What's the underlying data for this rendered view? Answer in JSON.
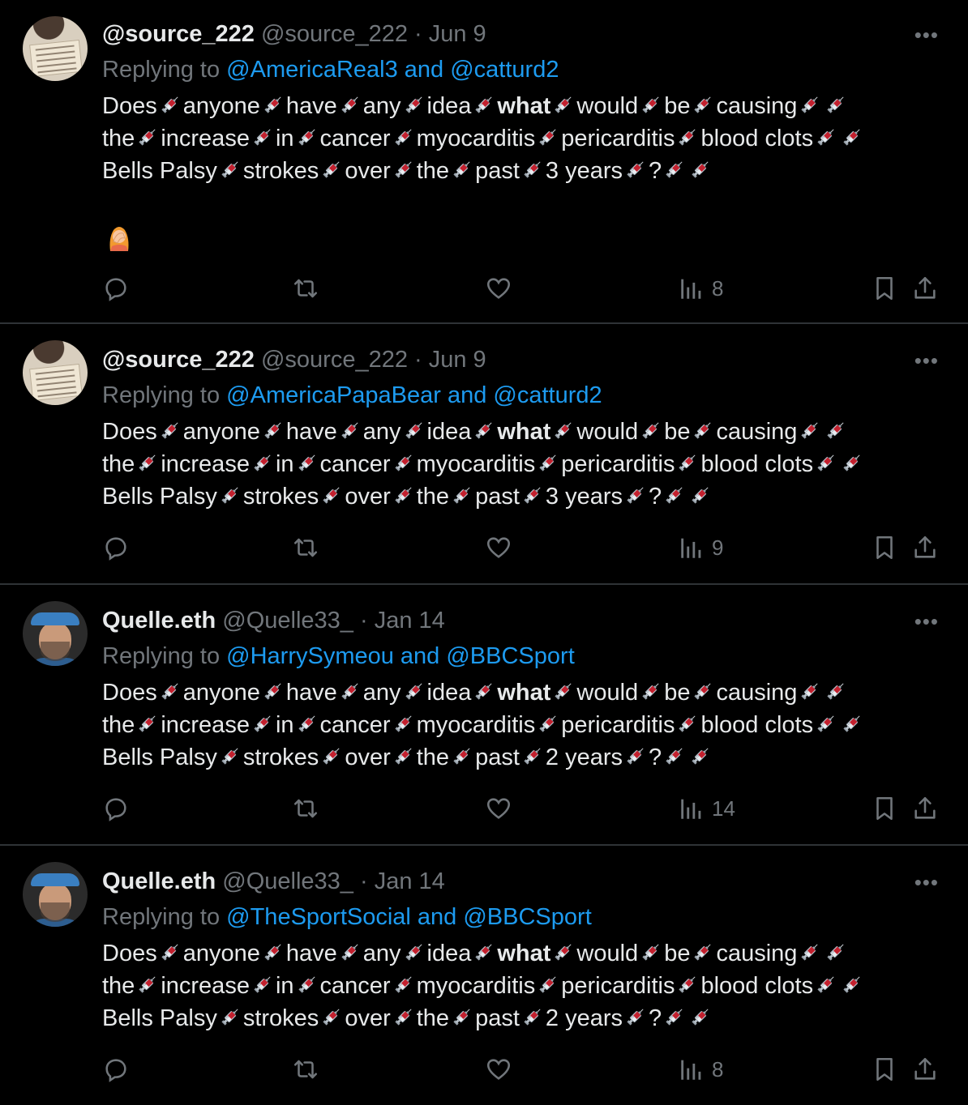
{
  "tweets": [
    {
      "display_name": "@source_222",
      "handle": "@source_222",
      "date": "· Jun 9",
      "replying_prefix": "Replying to",
      "replying_to": "@AmericaReal3 and @catturd2",
      "lines": [
        [
          "Does",
          "anyone",
          "have",
          "any",
          "idea",
          "what",
          "would",
          "be",
          "causing",
          ""
        ],
        [
          "the",
          "increase",
          "in",
          "cancer",
          "myocarditis",
          "pericarditis",
          "blood clots",
          ""
        ],
        [
          "Bells Palsy",
          "strokes",
          "over",
          "the",
          "past",
          "3 years",
          "?",
          ""
        ]
      ],
      "extra_emoji": "woman-facepalm-emoji",
      "views": "8",
      "avatar": "sign-avatar"
    },
    {
      "display_name": "@source_222",
      "handle": "@source_222",
      "date": "· Jun 9",
      "replying_prefix": "Replying to",
      "replying_to": "@AmericaPapaBear and @catturd2",
      "lines": [
        [
          "Does",
          "anyone",
          "have",
          "any",
          "idea",
          "what",
          "would",
          "be",
          "causing",
          ""
        ],
        [
          "the",
          "increase",
          "in",
          "cancer",
          "myocarditis",
          "pericarditis",
          "blood clots",
          ""
        ],
        [
          "Bells Palsy",
          "strokes",
          "over",
          "the",
          "past",
          "3 years",
          "?",
          ""
        ]
      ],
      "views": "9",
      "avatar": "sign-avatar"
    },
    {
      "display_name": "Quelle.eth",
      "handle": "@Quelle33_",
      "date": "· Jan 14",
      "replying_prefix": "Replying to",
      "replying_to": "@HarrySymeou and @BBCSport",
      "lines": [
        [
          "Does",
          "anyone",
          "have",
          "any",
          "idea",
          "what",
          "would",
          "be",
          "causing",
          ""
        ],
        [
          "the",
          "increase",
          "in",
          "cancer",
          "myocarditis",
          "pericarditis",
          "blood clots",
          ""
        ],
        [
          "Bells Palsy",
          "strokes",
          "over",
          "the",
          "past",
          "2 years",
          "?",
          ""
        ]
      ],
      "views": "14",
      "avatar": "face-avatar"
    },
    {
      "display_name": "Quelle.eth",
      "handle": "@Quelle33_",
      "date": "· Jan 14",
      "replying_prefix": "Replying to",
      "replying_to": "@TheSportSocial and @BBCSport",
      "lines": [
        [
          "Does",
          "anyone",
          "have",
          "any",
          "idea",
          "what",
          "would",
          "be",
          "causing",
          ""
        ],
        [
          "the",
          "increase",
          "in",
          "cancer",
          "myocarditis",
          "pericarditis",
          "blood clots",
          ""
        ],
        [
          "Bells Palsy",
          "strokes",
          "over",
          "the",
          "past",
          "2 years",
          "?",
          ""
        ]
      ],
      "views": "8",
      "avatar": "face-avatar"
    }
  ],
  "more_label": "•••",
  "icons": {
    "reply": "reply-icon",
    "retweet": "retweet-icon",
    "like": "heart-icon",
    "views": "views-chart-icon",
    "bookmark": "bookmark-icon",
    "share": "share-icon",
    "separator": "syringe-emoji"
  },
  "colors": {
    "background": "#000000",
    "text": "#e7e9ea",
    "muted": "#71767b",
    "link": "#1d9bf0",
    "divider": "#2f3336"
  }
}
